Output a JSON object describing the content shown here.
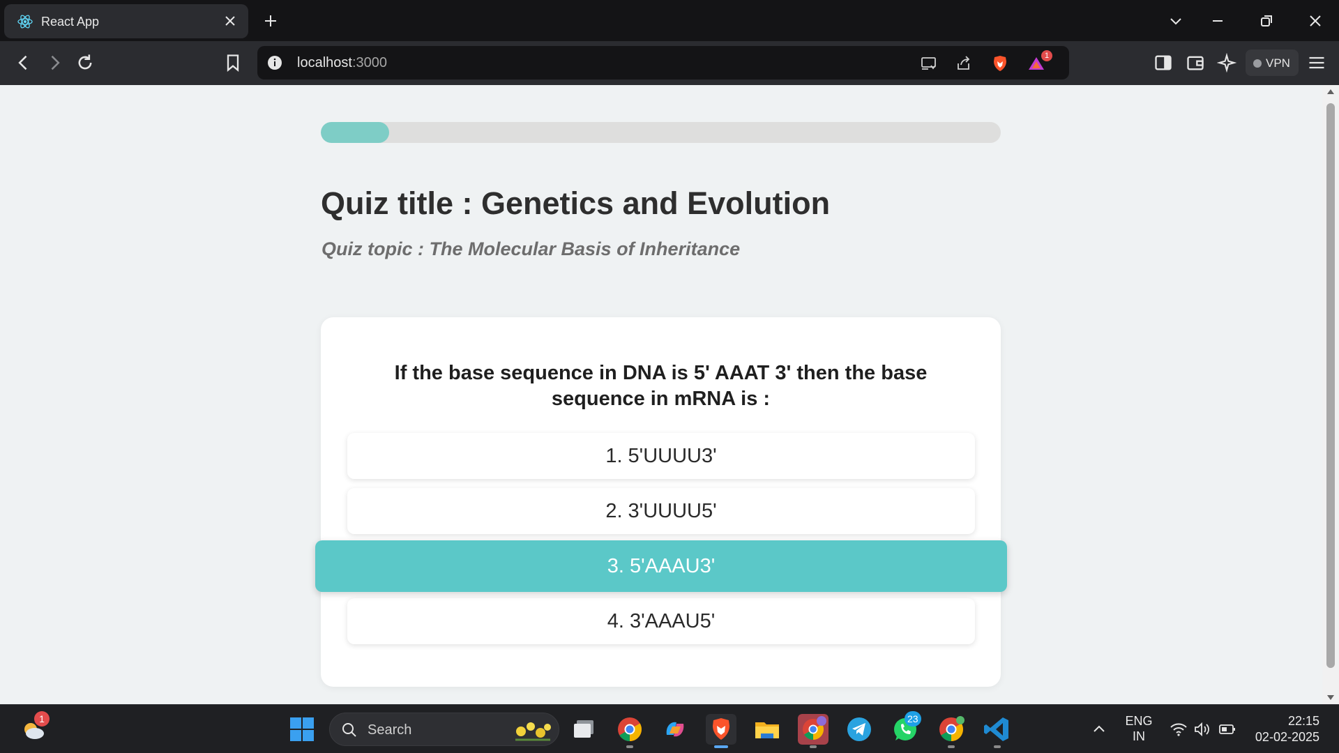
{
  "browser": {
    "tab_title": "React App",
    "url_host": "localhost",
    "url_port": ":3000",
    "vpn_label": "VPN",
    "notification_count": "1"
  },
  "quiz": {
    "progress_fraction": 0.1,
    "title": "Quiz title : Genetics and Evolution",
    "topic": "Quiz topic : The Molecular Basis of Inheritance",
    "question": "If the base sequence in DNA is 5' AAAT 3' then the base sequence in mRNA is :",
    "options": [
      {
        "label": "1. 5'UUUU3'",
        "selected": false
      },
      {
        "label": "2. 3'UUUU5'",
        "selected": false
      },
      {
        "label": "3. 5'AAAU3'",
        "selected": true
      },
      {
        "label": "4. 3'AAAU5'",
        "selected": false
      }
    ]
  },
  "colors": {
    "accent": "#5bc8c8",
    "progress": "#7ecdc6",
    "page_bg": "#eff2f3"
  },
  "taskbar": {
    "search_placeholder": "Search",
    "weather_badge": "1",
    "whatsapp_badge": "23",
    "language": "ENG",
    "region": "IN",
    "time": "22:15",
    "date": "02-02-2025",
    "icons": [
      "weather-icon",
      "windows-start-icon",
      "search-icon",
      "task-view-icon",
      "chrome-icon",
      "copilot-icon",
      "brave-icon",
      "file-explorer-icon",
      "chrome-profile-icon",
      "telegram-icon",
      "whatsapp-icon",
      "chrome-canary-icon",
      "vscode-icon"
    ]
  }
}
